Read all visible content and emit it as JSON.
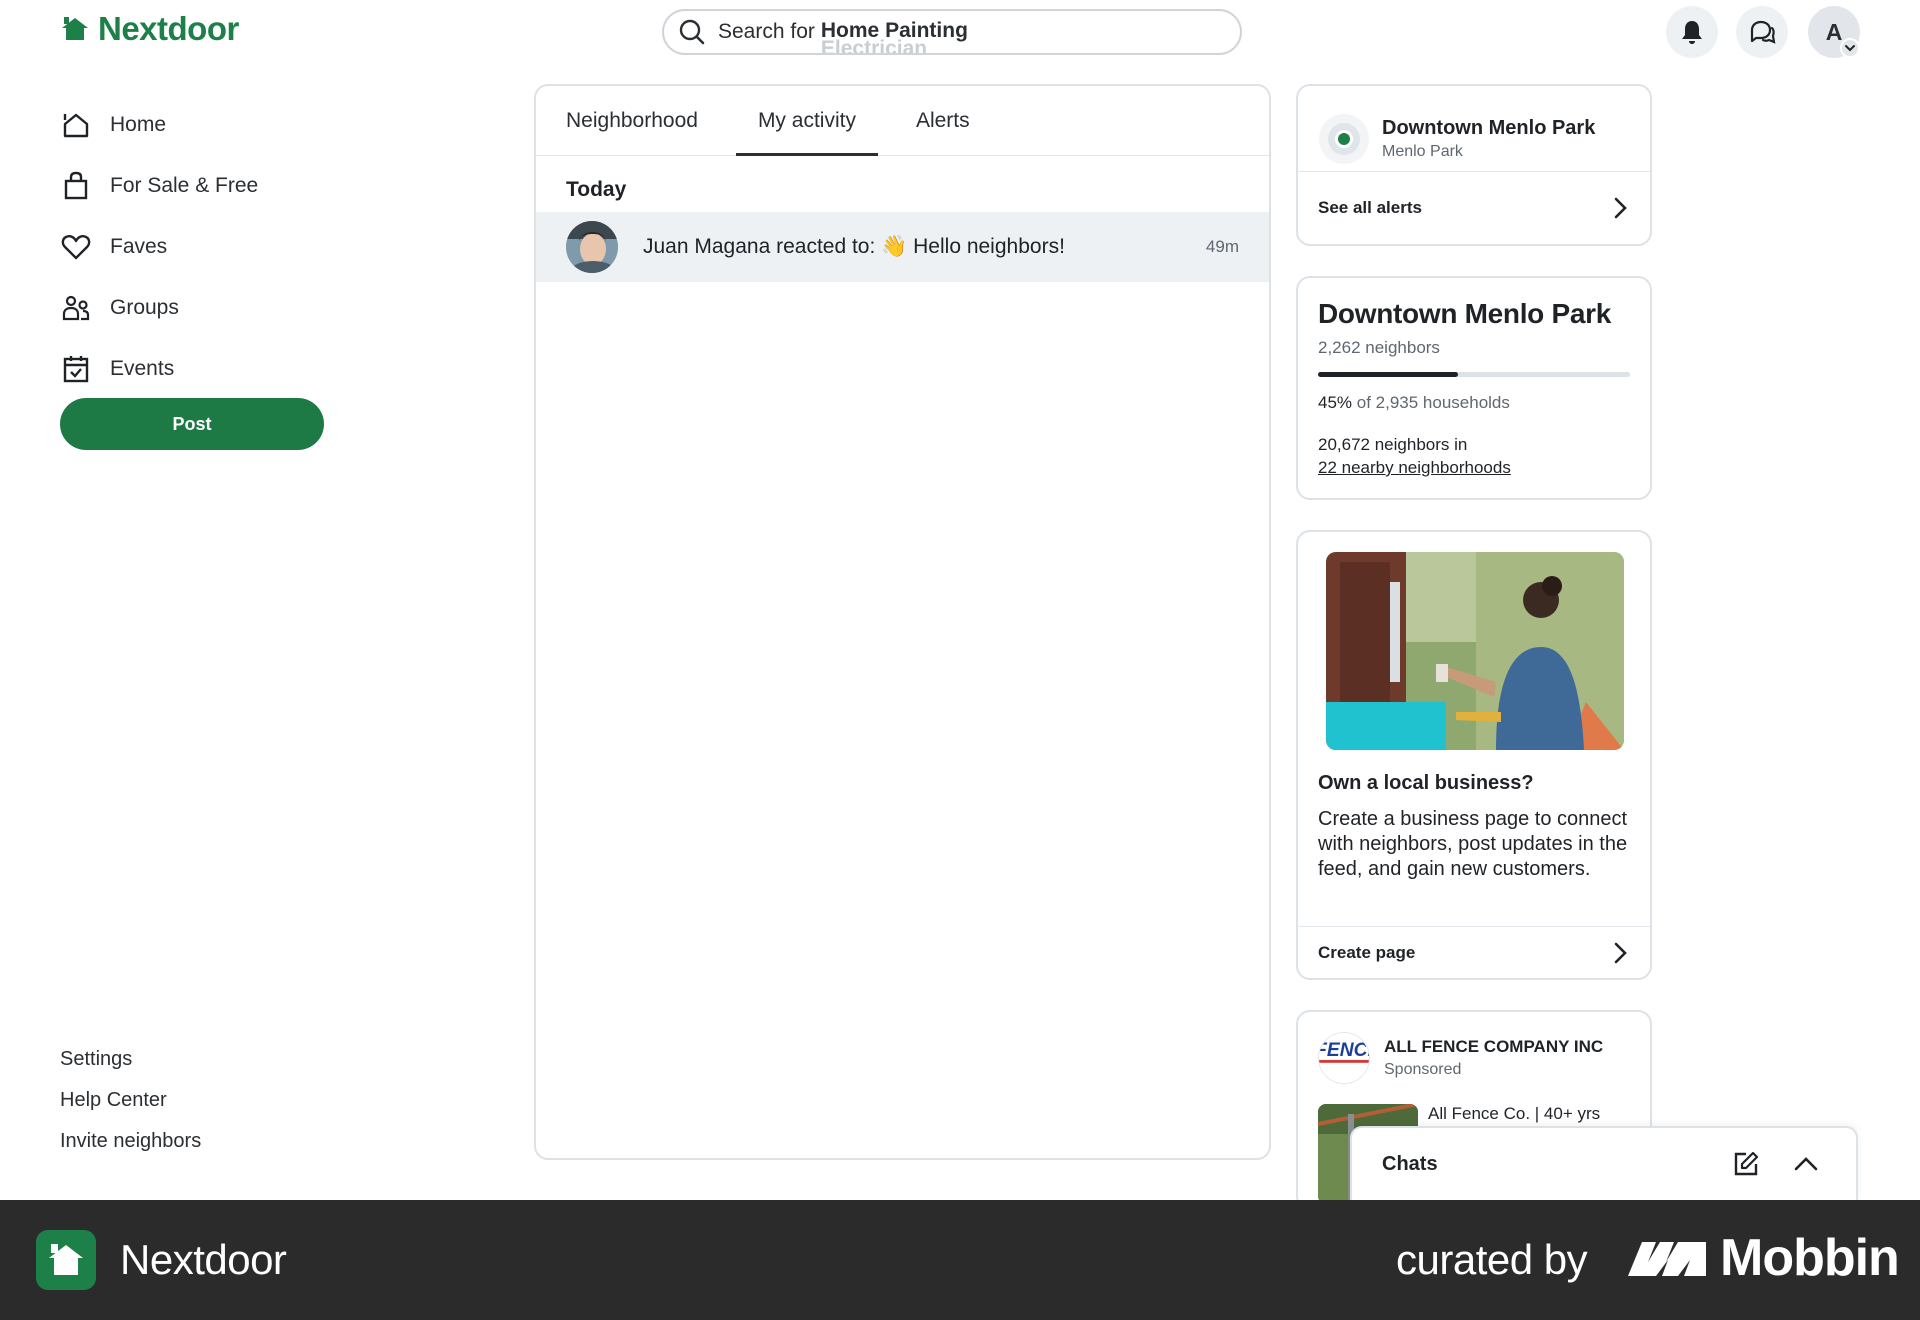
{
  "app": {
    "logo_text": "Nextdoor",
    "brand_color": "#1d8049"
  },
  "search": {
    "prefix": "Search for",
    "current_term": "Home Painting",
    "next_term": "Electrician"
  },
  "top_icons": [
    "bell-icon",
    "chat-bubbles-icon"
  ],
  "profile": {
    "initial": "A"
  },
  "nav": {
    "items": [
      {
        "label": "Home",
        "icon": "home-icon"
      },
      {
        "label": "For Sale & Free",
        "icon": "shopping-bag-icon"
      },
      {
        "label": "Faves",
        "icon": "heart-icon"
      },
      {
        "label": "Groups",
        "icon": "groups-icon"
      },
      {
        "label": "Events",
        "icon": "calendar-icon"
      }
    ],
    "post_label": "Post",
    "footer_links": [
      "Settings",
      "Help Center",
      "Invite neighbors"
    ]
  },
  "main": {
    "tabs": [
      "Neighborhood",
      "My activity",
      "Alerts"
    ],
    "active_tab": "My activity",
    "section_title": "Today",
    "activity": [
      {
        "text": "Juan Magana reacted to: 👋 Hello neighbors!",
        "time": "49m"
      }
    ]
  },
  "alerts_card": {
    "title": "Downtown Menlo Park",
    "subtitle": "Menlo Park",
    "link": "See all alerts"
  },
  "neighborhood_card": {
    "title": "Downtown Menlo Park",
    "neighbors": "2,262 neighbors",
    "progress_percent": 45,
    "pct_label": "45%",
    "pct_rest": "of 2,935 households",
    "nearby_count": "20,672 neighbors in",
    "nearby_link": "22 nearby neighborhoods"
  },
  "business_card": {
    "title": "Own a local business?",
    "body": "Create a business page to connect with neighbors, post updates in the feed, and gain new customers.",
    "link": "Create page"
  },
  "sponsored_card": {
    "logo_text": "FENCE",
    "company": "ALL FENCE COMPANY INC",
    "label": "Sponsored",
    "ad_text": "All Fence Co. | 40+ yrs"
  },
  "chats": {
    "title": "Chats"
  },
  "footer": {
    "app_name": "Nextdoor",
    "curated": "curated by",
    "brand": "Mobbin"
  }
}
